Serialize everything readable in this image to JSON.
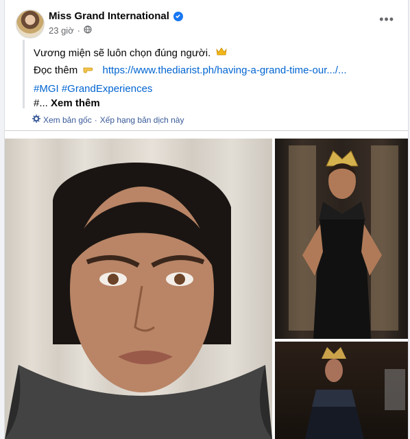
{
  "post": {
    "author": "Miss Grand International",
    "time": "23 giờ",
    "line1": "Vương miện sẽ luôn chọn đúng người.",
    "read_more_label": "Đọc thêm",
    "link": "https://www.thediarist.ph/having-a-grand-time-our.../...",
    "hashtags": "#MGI #GrandExperiences",
    "truncated": "#...",
    "see_more": "Xem thêm",
    "see_original": "Xem bản gốc",
    "rate_translation": "Xếp hạng bản dịch này"
  },
  "colors": {
    "link": "#0064d1",
    "verified": "#1877f2",
    "translate": "#385898"
  },
  "icons": [
    "verified-icon",
    "globe-icon",
    "more-options-icon",
    "crown-emoji",
    "pointing-hand-emoji",
    "gear-icon"
  ]
}
